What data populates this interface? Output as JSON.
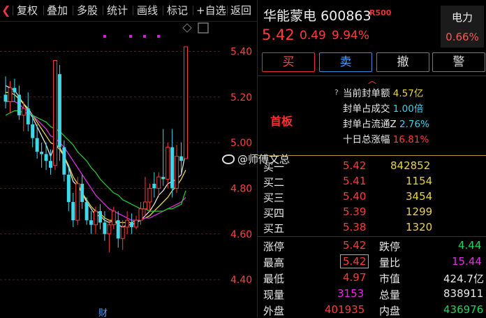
{
  "toolbar": {
    "back_glyph": "❮",
    "items": [
      "复权",
      "叠加",
      "多股",
      "统计",
      "画线",
      "标记",
      "+自选",
      "返回"
    ]
  },
  "chart_data": {
    "type": "candlestick",
    "y_ticks": [
      5.4,
      5.2,
      5.0,
      4.8,
      4.6,
      4.4
    ],
    "y_tick_labels": [
      "5.40",
      "5.20",
      "5.00",
      "4.80",
      "4.60",
      "4.40"
    ],
    "ylim": [
      4.29,
      5.53
    ],
    "grid": "dashed horizontal",
    "candles": [
      {
        "o": 5.21,
        "h": 5.29,
        "l": 5.15,
        "c": 5.18
      },
      {
        "o": 5.18,
        "h": 5.27,
        "l": 5.13,
        "c": 5.24
      },
      {
        "o": 5.24,
        "h": 5.28,
        "l": 5.18,
        "c": 5.22
      },
      {
        "o": 5.21,
        "h": 5.25,
        "l": 5.1,
        "c": 5.12
      },
      {
        "o": 5.12,
        "h": 5.18,
        "l": 5.05,
        "c": 5.15
      },
      {
        "o": 5.15,
        "h": 5.22,
        "l": 5.05,
        "c": 5.08
      },
      {
        "o": 5.08,
        "h": 5.12,
        "l": 4.98,
        "c": 5.02
      },
      {
        "o": 5.02,
        "h": 5.08,
        "l": 4.93,
        "c": 4.96
      },
      {
        "o": 4.96,
        "h": 5.0,
        "l": 4.89,
        "c": 4.95
      },
      {
        "o": 4.95,
        "h": 5.0,
        "l": 4.88,
        "c": 4.92
      },
      {
        "o": 4.92,
        "h": 4.97,
        "l": 4.86,
        "c": 4.89
      },
      {
        "o": 4.9,
        "h": 5.36,
        "l": 4.88,
        "c": 5.36
      },
      {
        "o": 5.3,
        "h": 5.34,
        "l": 4.92,
        "c": 4.98
      },
      {
        "o": 4.98,
        "h": 5.01,
        "l": 4.83,
        "c": 4.86
      },
      {
        "o": 4.86,
        "h": 4.9,
        "l": 4.7,
        "c": 4.74
      },
      {
        "o": 4.74,
        "h": 4.78,
        "l": 4.63,
        "c": 4.66
      },
      {
        "o": 4.66,
        "h": 4.85,
        "l": 4.64,
        "c": 4.82
      },
      {
        "o": 4.82,
        "h": 4.86,
        "l": 4.71,
        "c": 4.74
      },
      {
        "o": 4.74,
        "h": 4.76,
        "l": 4.64,
        "c": 4.66
      },
      {
        "o": 4.66,
        "h": 4.7,
        "l": 4.6,
        "c": 4.64
      },
      {
        "o": 4.64,
        "h": 4.72,
        "l": 4.6,
        "c": 4.7
      },
      {
        "o": 4.7,
        "h": 4.73,
        "l": 4.62,
        "c": 4.65
      },
      {
        "o": 4.65,
        "h": 4.7,
        "l": 4.57,
        "c": 4.6
      },
      {
        "o": 4.6,
        "h": 4.66,
        "l": 4.52,
        "c": 4.64
      },
      {
        "o": 4.64,
        "h": 4.72,
        "l": 4.62,
        "c": 4.7
      },
      {
        "o": 4.66,
        "h": 4.7,
        "l": 4.54,
        "c": 4.58
      },
      {
        "o": 4.58,
        "h": 4.66,
        "l": 4.53,
        "c": 4.63
      },
      {
        "o": 4.63,
        "h": 4.7,
        "l": 4.6,
        "c": 4.66
      },
      {
        "o": 4.65,
        "h": 4.69,
        "l": 4.6,
        "c": 4.63
      },
      {
        "o": 4.63,
        "h": 4.68,
        "l": 4.62,
        "c": 4.66
      },
      {
        "o": 4.66,
        "h": 4.74,
        "l": 4.64,
        "c": 4.71
      },
      {
        "o": 4.71,
        "h": 4.85,
        "l": 4.68,
        "c": 4.74
      },
      {
        "o": 4.74,
        "h": 4.82,
        "l": 4.7,
        "c": 4.8
      },
      {
        "o": 4.82,
        "h": 4.87,
        "l": 4.76,
        "c": 4.8
      },
      {
        "o": 4.8,
        "h": 4.87,
        "l": 4.76,
        "c": 4.85
      },
      {
        "o": 4.85,
        "h": 5.06,
        "l": 4.81,
        "c": 4.84
      },
      {
        "o": 4.84,
        "h": 5.0,
        "l": 4.8,
        "c": 4.98
      },
      {
        "o": 4.98,
        "h": 5.06,
        "l": 4.76,
        "c": 4.8
      },
      {
        "o": 4.8,
        "h": 4.99,
        "l": 4.78,
        "c": 4.94
      },
      {
        "o": 4.94,
        "h": 5.0,
        "l": 4.86,
        "c": 4.92
      },
      {
        "o": 4.93,
        "h": 5.42,
        "l": 4.93,
        "c": 5.42
      }
    ],
    "ma": [
      {
        "color": "#e0e0e0",
        "values": [
          5.25,
          5.24,
          5.23,
          5.2,
          5.17,
          5.14,
          5.11,
          5.07,
          5.03,
          4.99,
          4.94,
          4.99,
          4.98,
          4.94,
          4.89,
          4.83,
          4.81,
          4.78,
          4.74,
          4.71,
          4.68,
          4.68,
          4.66,
          4.65,
          4.66,
          4.64,
          4.63,
          4.64,
          4.64,
          4.65,
          4.66,
          4.68,
          4.7,
          4.73,
          4.77,
          4.79,
          4.82,
          4.83,
          4.84,
          4.86,
          4.96
        ]
      },
      {
        "color": "#e8d443",
        "values": [
          5.22,
          5.22,
          5.21,
          5.19,
          5.17,
          5.15,
          5.12,
          5.09,
          5.06,
          5.03,
          5.0,
          4.99,
          4.97,
          4.94,
          4.9,
          4.85,
          4.82,
          4.78,
          4.75,
          4.72,
          4.7,
          4.69,
          4.67,
          4.66,
          4.66,
          4.65,
          4.65,
          4.65,
          4.65,
          4.66,
          4.66,
          4.67,
          4.68,
          4.7,
          4.72,
          4.74,
          4.76,
          4.79,
          4.81,
          4.84,
          4.88
        ]
      },
      {
        "color": "#e42ce4",
        "values": [
          5.18,
          5.18,
          5.18,
          5.17,
          5.15,
          5.14,
          5.12,
          5.1,
          5.08,
          5.06,
          5.03,
          5.02,
          5.0,
          4.98,
          4.95,
          4.92,
          4.89,
          4.86,
          4.83,
          4.8,
          4.77,
          4.75,
          4.73,
          4.71,
          4.7,
          4.69,
          4.68,
          4.67,
          4.66,
          4.66,
          4.66,
          4.67,
          4.67,
          4.68,
          4.69,
          4.7,
          4.71,
          4.72,
          4.73,
          4.74,
          4.76
        ]
      },
      {
        "color": "#22c832",
        "values": [
          5.12,
          5.13,
          5.14,
          5.14,
          5.13,
          5.13,
          5.12,
          5.11,
          5.1,
          5.09,
          5.07,
          5.06,
          5.05,
          5.03,
          5.01,
          4.99,
          4.96,
          4.94,
          4.92,
          4.89,
          4.87,
          4.84,
          4.82,
          4.8,
          4.78,
          4.77,
          4.75,
          4.74,
          4.73,
          4.72,
          4.71,
          4.71,
          4.7,
          4.7,
          4.7,
          4.7,
          4.71,
          4.71,
          4.72,
          4.73,
          4.79
        ]
      }
    ],
    "annotation_label": "财"
  },
  "panel": {
    "stock_name": "华能蒙电",
    "stock_code": "600863",
    "r_badge": "R500",
    "price": "5.42",
    "change": "0.49",
    "change_pct": "9.94%",
    "industry": {
      "name": "电力",
      "pct": "0.66%"
    },
    "buttons": [
      "买",
      "卖",
      "撤",
      "警"
    ],
    "collapse_icon": "︿",
    "limit_tag": "首板",
    "seal_info": [
      {
        "label": "当前封单额",
        "value": "4.57亿",
        "value_class": "v-yellow"
      },
      {
        "label": "封单占成交",
        "value": "1.00倍",
        "value_class": "v-cyan"
      },
      {
        "label": "封单占流通Z",
        "value": "2.76%",
        "value_class": "v-cyan"
      },
      {
        "label": "十日总涨幅",
        "value": "16.81%",
        "value_class": "v-red"
      }
    ],
    "bids": [
      {
        "label": "买一",
        "price": "5.42",
        "vol": "842852"
      },
      {
        "label": "买二",
        "price": "5.41",
        "vol": "1154"
      },
      {
        "label": "买三",
        "price": "5.40",
        "vol": "3454"
      },
      {
        "label": "买四",
        "price": "5.39",
        "vol": "1299"
      },
      {
        "label": "买五",
        "price": "5.38",
        "vol": "1320"
      }
    ],
    "stats": [
      {
        "l1": "涨停",
        "v1": "5.42",
        "c1": "v-red",
        "l2": "跌停",
        "v2": "4.44",
        "c2": "v-green"
      },
      {
        "l1": "最高",
        "v1": "5.42",
        "c1": "v-red",
        "l2": "量比",
        "v2": "15.44",
        "c2": "v-magenta"
      },
      {
        "l1": "最低",
        "v1": "4.97",
        "c1": "v-red",
        "l2": "市值",
        "v2": "424.7亿",
        "c2": "lbl"
      },
      {
        "l1": "现量",
        "v1": "3153",
        "c1": "v-magenta",
        "l2": "总量",
        "v2": "838911",
        "c2": "lbl"
      },
      {
        "l1": "外盘",
        "v1": "401935",
        "c1": "v-red",
        "l2": "内盘",
        "v2": "436976",
        "c2": "v-green"
      }
    ]
  },
  "watermark": "@师傅文总"
}
